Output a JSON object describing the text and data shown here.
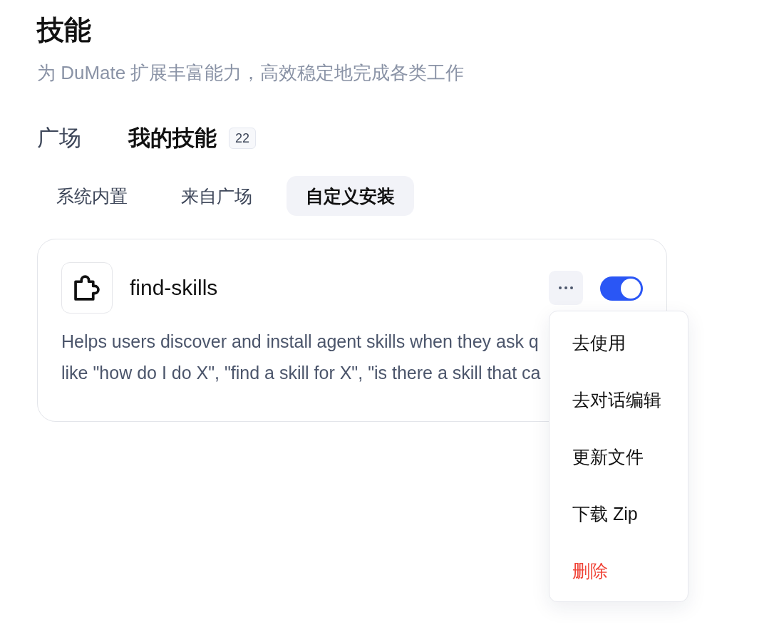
{
  "page": {
    "title": "技能",
    "subtitle": "为 DuMate 扩展丰富能力，高效稳定地完成各类工作"
  },
  "tabs": [
    {
      "label": "广场",
      "selected": false
    },
    {
      "label": "我的技能",
      "selected": true,
      "badge": "22"
    }
  ],
  "subtabs": [
    {
      "label": "系统内置",
      "selected": false
    },
    {
      "label": "来自广场",
      "selected": false
    },
    {
      "label": "自定义安装",
      "selected": true
    }
  ],
  "skills": [
    {
      "name": "find-skills",
      "description_lines": [
        "Helps users discover and install agent skills when they ask q",
        "like \"how do I do X\", \"find a skill for X\", \"is there a skill that ca"
      ],
      "enabled": true,
      "menu_open": true,
      "menu": [
        {
          "label": "去使用",
          "kind": "action"
        },
        {
          "label": "去对话编辑",
          "kind": "action"
        },
        {
          "label": "更新文件",
          "kind": "action"
        },
        {
          "label": "下载 Zip",
          "kind": "action"
        },
        {
          "label": "删除",
          "kind": "danger"
        }
      ]
    }
  ]
}
